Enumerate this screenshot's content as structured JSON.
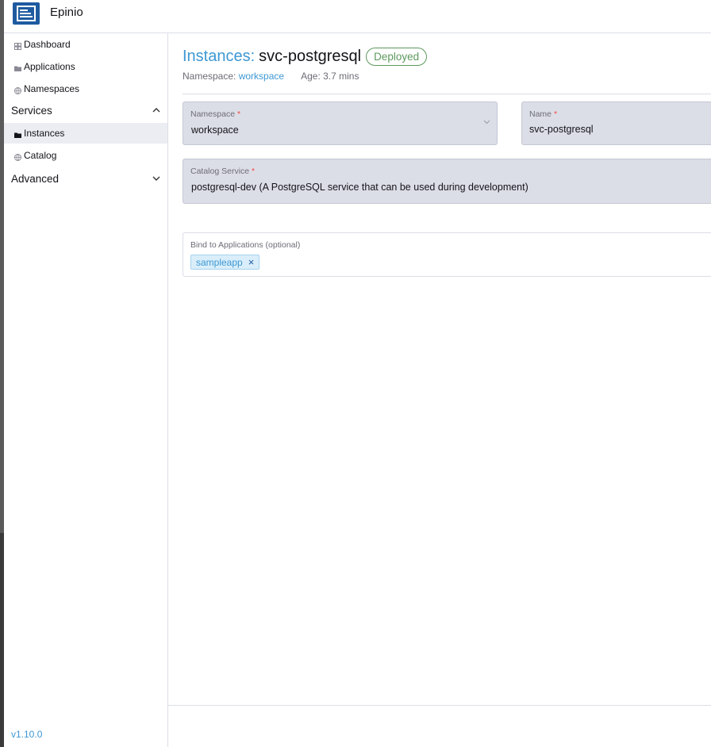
{
  "app": {
    "name": "Epinio",
    "version": "v1.10.0"
  },
  "sidebar": {
    "items": [
      {
        "label": "Dashboard",
        "icon": "dashboard-icon"
      },
      {
        "label": "Applications",
        "icon": "folder-icon"
      },
      {
        "label": "Namespaces",
        "icon": "globe-icon"
      }
    ],
    "services_group": {
      "label": "Services",
      "expanded": true,
      "items": [
        {
          "label": "Instances",
          "icon": "folder-icon",
          "active": true
        },
        {
          "label": "Catalog",
          "icon": "globe-icon"
        }
      ]
    },
    "advanced_group": {
      "label": "Advanced",
      "expanded": false
    }
  },
  "page": {
    "title_prefix": "Instances:",
    "title_name": "svc-postgresql",
    "status": "Deployed",
    "namespace_label": "Namespace:",
    "namespace_value": "workspace",
    "age_label": "Age:",
    "age_value": "3.7 mins"
  },
  "form": {
    "namespace": {
      "label": "Namespace",
      "required_mark": "*",
      "value": "workspace"
    },
    "name": {
      "label": "Name",
      "required_mark": "*",
      "value": "svc-postgresql"
    },
    "catalog_service": {
      "label": "Catalog Service",
      "required_mark": "*",
      "value": "postgresql-dev (A PostgreSQL service that can be used during development)"
    },
    "bind": {
      "label": "Bind to Applications (optional)",
      "tags": [
        "sampleapp"
      ],
      "remove_symbol": "×"
    }
  },
  "colors": {
    "accent": "#3d98d3",
    "success": "#5d995d",
    "brand": "#1e5aa0",
    "required": "#f64747"
  }
}
